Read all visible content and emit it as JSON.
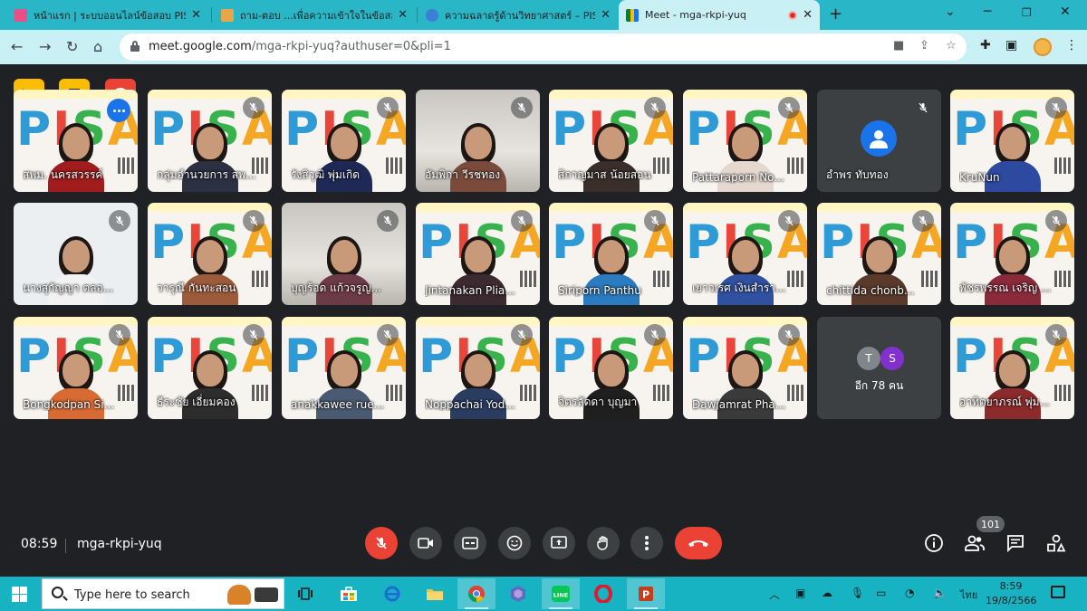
{
  "browser": {
    "tabs": [
      {
        "title": "หน้าแรก | ระบบออนไลน์ข้อสอบ PISA",
        "favicon_color": "#e94f86"
      },
      {
        "title": "ถาม-ตอบ ...เพื่อความเข้าใจในข้อสอบ P",
        "favicon_color": "#e7a64b"
      },
      {
        "title": "ความฉลาดรู้ด้านวิทยาศาสตร์ – PISA",
        "favicon_color": "#3d7ed6"
      },
      {
        "title": "Meet - mga-rkpi-yuq",
        "favicon_color": "#34a853"
      }
    ],
    "url_host": "meet.google.com",
    "url_path": "/mga-rkpi-yuq?authuser=0&pli=1"
  },
  "meeting": {
    "time": "08:59",
    "code": "mga-rkpi-yuq",
    "participant_count": "101",
    "more_others": {
      "initials": [
        "T",
        "S"
      ],
      "initial_colors": [
        "#80868b",
        "#8430ce"
      ],
      "label": "อีก 78 คน"
    },
    "participants": [
      {
        "name": "สพม. นครสวรรค์",
        "bg": "pisa",
        "shirt": "#a11c1c",
        "muted": false,
        "speaking": true
      },
      {
        "name": "กลุ่มอำนวยการ สพ...",
        "bg": "pisa",
        "shirt": "#2b3042",
        "muted": true
      },
      {
        "name": "รังสิวุฒิ พุ่มเกิด",
        "bg": "pisa",
        "shirt": "#1e2a55",
        "muted": true
      },
      {
        "name": "อัมพิกา วีรชทอง",
        "bg": "room",
        "shirt": "#7a4b3c",
        "muted": true
      },
      {
        "name": "สิกาญมาส น้อยสอน",
        "bg": "pisa",
        "shirt": "#3a2e2a",
        "muted": true
      },
      {
        "name": "Pattaraporn No...",
        "bg": "pisa",
        "shirt": "#e4d8cf",
        "muted": true
      },
      {
        "name": "อำพร ทับทอง",
        "bg": "plain",
        "shirt": "",
        "muted": true,
        "avatar": true
      },
      {
        "name": "KruNun",
        "bg": "pisa",
        "shirt": "#2d4aa0",
        "muted": true
      },
      {
        "name": "นางสุกัญญา ตลอ...",
        "bg": "white",
        "shirt": "#f2f2f2",
        "muted": true
      },
      {
        "name": "วารุณี กันทะสอน",
        "bg": "pisa",
        "shirt": "#9c5b3a",
        "muted": true
      },
      {
        "name": "บุญร้อด แก้วจรูญ...",
        "bg": "room",
        "shirt": "#6d3a48",
        "muted": true
      },
      {
        "name": "Jintanakan Plia...",
        "bg": "pisa",
        "shirt": "#3b2a30",
        "muted": true
      },
      {
        "name": "Siriporn Panthu",
        "bg": "pisa",
        "shirt": "#2a7bbf",
        "muted": true
      },
      {
        "name": "เยาวเรศ เงินสำรา...",
        "bg": "pisa",
        "shirt": "#3050a0",
        "muted": true
      },
      {
        "name": "chittida chonb...",
        "bg": "pisa",
        "shirt": "#5a3a2a",
        "muted": true
      },
      {
        "name": "พัชรพรรณ เจริญ ...",
        "bg": "pisa",
        "shirt": "#8a2a3a",
        "muted": true
      },
      {
        "name": "Bongkodpan Si...",
        "bg": "pisa",
        "shirt": "#d86a33",
        "muted": true
      },
      {
        "name": "ธีระชัย เอี่ยมคอง",
        "bg": "pisa",
        "shirt": "#2d2d2d",
        "muted": true
      },
      {
        "name": "anakkawee rue...",
        "bg": "pisa",
        "shirt": "#4a5a70",
        "muted": true
      },
      {
        "name": "Noppachai Yod...",
        "bg": "pisa",
        "shirt": "#2a3c60",
        "muted": true
      },
      {
        "name": "จิตรลัดดา บุญมา",
        "bg": "pisa",
        "shirt": "#1f1f1f",
        "muted": true
      },
      {
        "name": "Dawjamrat Pha...",
        "bg": "pisa",
        "shirt": "#3a3a3a",
        "muted": true
      },
      {
        "name": "อาทิตยาภรณ์ พุ่ม...",
        "bg": "pisa",
        "shirt": "#8c2b2b",
        "muted": true
      }
    ]
  },
  "taskbar": {
    "search_placeholder": "Type here to search",
    "lang": "ไทย",
    "time": "8:59",
    "date": "19/8/2566"
  },
  "pisa_logo_text": [
    "P",
    "I",
    "S",
    "A"
  ],
  "colors": {
    "chrome_tabbar": "#29b6c6",
    "chrome_toolbar": "#c8f0f5",
    "meet_bg": "#202124",
    "danger": "#ea4335",
    "warning": "#fbbc04",
    "taskbar": "#17b3c3"
  }
}
